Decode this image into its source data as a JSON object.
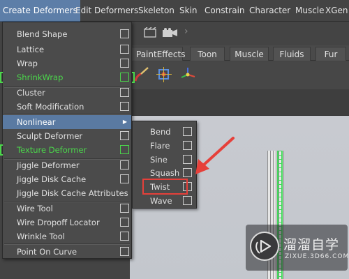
{
  "menubar": {
    "items": [
      "Create Deformers",
      "Edit Deformers",
      "Skeleton",
      "Skin",
      "Constrain",
      "Character",
      "Muscle",
      "XGen"
    ]
  },
  "shelf": {
    "tabs": [
      "PaintEffects",
      "Toon",
      "Muscle",
      "Fluids",
      "Fur"
    ]
  },
  "dropdown": {
    "items": [
      "Blend Shape",
      "Lattice",
      "Wrap",
      "ShrinkWrap",
      "Cluster",
      "Soft Modification",
      "Nonlinear",
      "Sculpt Deformer",
      "Texture Deformer",
      "Jiggle Deformer",
      "Jiggle Disk Cache",
      "Jiggle Disk Cache Attributes",
      "Wire Tool",
      "Wire Dropoff Locator",
      "Wrinkle Tool",
      "Point On Curve"
    ],
    "highlighted": "Nonlinear"
  },
  "submenu": {
    "items": [
      "Bend",
      "Flare",
      "Sine",
      "Squash",
      "Twist",
      "Wave"
    ],
    "highlighted": "Twist"
  },
  "watermark": {
    "title": "溜溜自学",
    "subtitle": "ZIXUE.3D66.COM"
  },
  "colors": {
    "menu_highlight": "#5a7aa2",
    "green_text": "#4bd84b",
    "annotation_red": "#e6403a"
  }
}
